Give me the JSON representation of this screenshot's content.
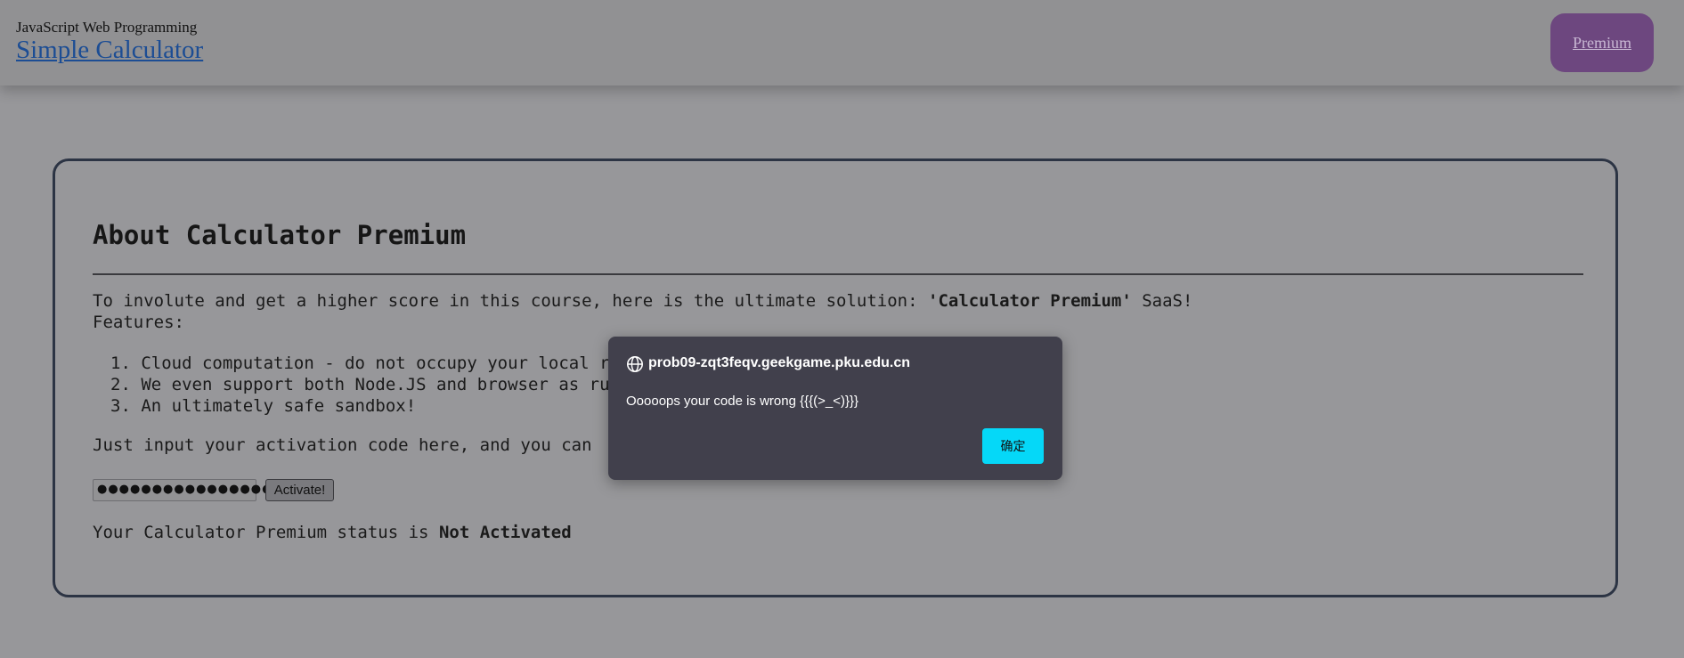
{
  "header": {
    "course": "JavaScript Web Programming",
    "title": "Simple Calculator",
    "premium_link": "Premium"
  },
  "about": {
    "title": "About Calculator Premium",
    "intro_prefix": "To involute and get a higher score in this course, here is the ultimate solution: ",
    "intro_product": "'Calculator Premium'",
    "intro_suffix": " SaaS!",
    "features_label": "Features:",
    "features": [
      "1. Cloud computation - do not occupy your local r",
      "2. We even support both Node.JS and browser as ru",
      "3. An ultimately safe sandbox!"
    ],
    "activation_prompt": "Just input your activation code here, and you can",
    "code_value": "●●●●●●●●●●●●●●●●●",
    "activate_label": "Activate!",
    "status_prefix": "Your Calculator Premium status is ",
    "status_value": "Not Activated"
  },
  "dialog": {
    "origin": "prob09-zqt3feqv.geekgame.pku.edu.cn",
    "message": "Ooooops your code is wrong {{{(>_<)}}}",
    "ok_label": "确定",
    "origin_icon": "globe-icon"
  },
  "colors": {
    "premium_button": "#6d477f",
    "dialog_bg": "#41404c",
    "ok_button": "#05d8f8",
    "card_border": "#2c3444",
    "link": "#1c4d94"
  }
}
